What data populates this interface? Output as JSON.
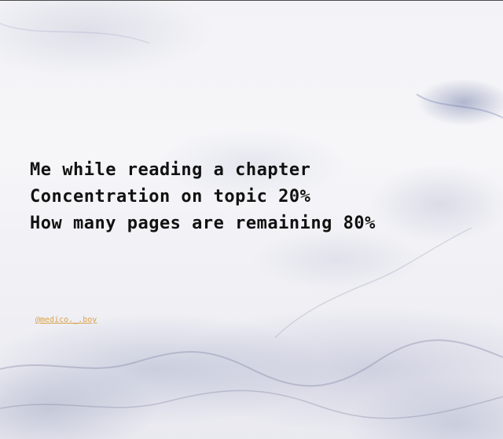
{
  "caption": {
    "line1": "Me while reading a chapter",
    "line2": "Concentration on topic 20%",
    "line3": "How many pages are remaining 80%"
  },
  "handle": {
    "text": "@medico._.boy"
  },
  "colors": {
    "text": "#111111",
    "handle": "#d9a24a",
    "background": "#f3f3f7"
  }
}
